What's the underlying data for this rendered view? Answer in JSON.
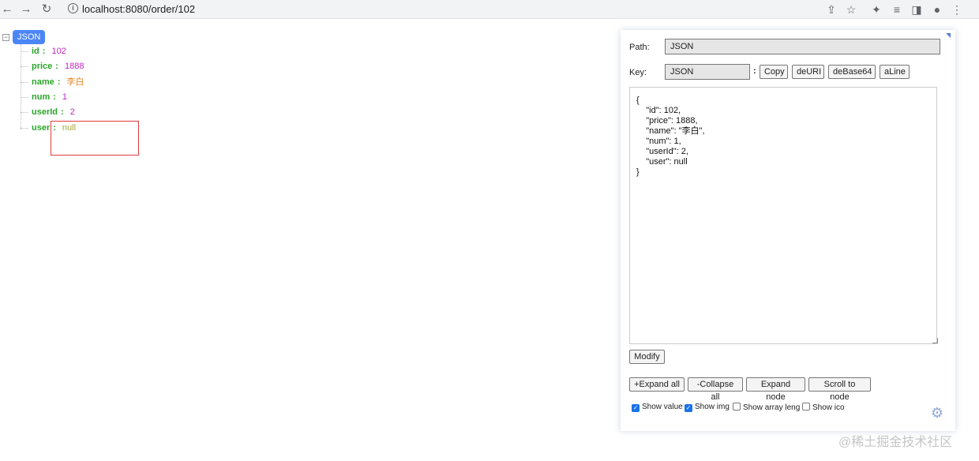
{
  "browser": {
    "url": "localhost:8080/order/102",
    "icons": [
      "back-arrow-icon",
      "forward-arrow-icon",
      "reload-icon",
      "info-icon",
      "share-icon",
      "star-icon",
      "extensions-icon",
      "reading-list-icon",
      "side-panel-icon",
      "profile-icon",
      "menu-icon"
    ]
  },
  "tree": {
    "root_label": "JSON",
    "toggle": "−",
    "nodes": [
      {
        "key": "id",
        "value": "102",
        "type": "num"
      },
      {
        "key": "price",
        "value": "1888",
        "type": "num"
      },
      {
        "key": "name",
        "value": "李白",
        "type": "str"
      },
      {
        "key": "num",
        "value": "1",
        "type": "num"
      },
      {
        "key": "userId",
        "value": "2",
        "type": "num"
      },
      {
        "key": "user",
        "value": "null",
        "type": "null"
      }
    ]
  },
  "panel": {
    "path_label": "Path:",
    "path_value": "JSON",
    "key_label": "Key:",
    "key_value": "JSON",
    "key_colon": ":",
    "buttons": {
      "copy": "Copy",
      "deuri": "deURI",
      "debase64": "deBase64",
      "aline": "aLine",
      "modify": "Modify",
      "expand_all": "+Expand all",
      "collapse_all": "-Collapse all",
      "expand_node": "Expand node",
      "scroll_to_node": "Scroll to node"
    },
    "editor_text": "{\n    \"id\": 102,\n    \"price\": 1888,\n    \"name\": \"李白\",\n    \"num\": 1,\n    \"userId\": 2,\n    \"user\": null\n}",
    "checkboxes": [
      {
        "label": "Show value",
        "checked": true
      },
      {
        "label": "Show img",
        "checked": true
      },
      {
        "label": "Show array leng",
        "checked": false
      },
      {
        "label": "Show ico",
        "checked": false
      }
    ]
  },
  "watermark": "@稀土掘金技术社区"
}
